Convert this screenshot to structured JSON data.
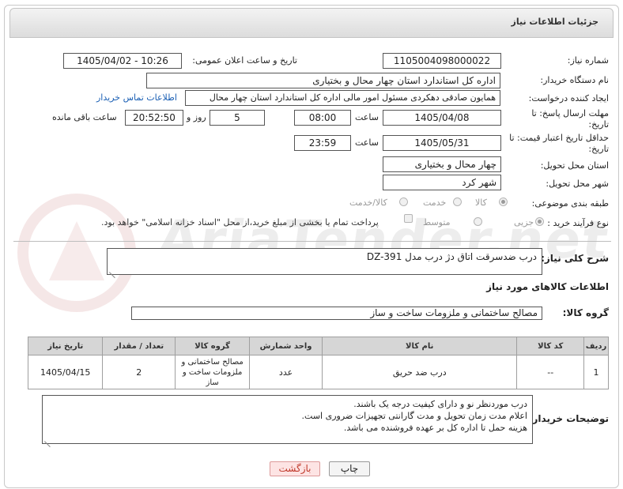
{
  "header": {
    "title": "جزئیات اطلاعات نیاز"
  },
  "form": {
    "need_number_label": "شماره نیاز:",
    "need_number": "1105004098000022",
    "announce_label": "تاریخ و ساعت اعلان عمومی:",
    "announce_value": "1405/04/02 - 10:26",
    "buyer_label": "نام دستگاه خریدار:",
    "buyer_value": "اداره کل استاندارد استان چهار محال و بختیاری",
    "creator_label": "ایجاد کننده درخواست:",
    "creator_value": "همایون صادقی دهکردی مسئول امور مالی اداره کل استاندارد استان چهار محال",
    "contact_link": "اطلاعات تماس خریدار",
    "reply_label": "مهلت ارسال پاسخ: تا تاریخ:",
    "reply_date": "1405/04/08",
    "time_word": "ساعت",
    "reply_time": "08:00",
    "days_value": "5",
    "days_word": "روز و",
    "remaining_value": "20:52:50",
    "remaining_word": "ساعت باقی مانده",
    "validity_label": "حداقل تاریخ اعتبار قیمت: تا تاریخ:",
    "validity_date": "1405/05/31",
    "validity_time": "23:59",
    "province_label": "استان محل تحویل:",
    "province_value": "چهار محال و بختیاری",
    "city_label": "شهر محل تحویل:",
    "city_value": "شهر کرد",
    "category_label": "طبقه بندی موضوعی:",
    "category_options": [
      "کالا",
      "خدمت",
      "کالا/خدمت"
    ],
    "category_selected": "کالا",
    "process_label": "نوع فرآیند خرید :",
    "process_options": [
      "جزیی",
      "متوسط"
    ],
    "process_selected": "جزیی",
    "payment_text": "پرداخت تمام یا بخشی از مبلغ خرید،از محل \"اسناد خزانه اسلامی\" خواهد بود."
  },
  "description": {
    "label": "شرح کلی نیاز:",
    "value": "درب ضدسرقت اتاق دژ درب مدل DZ-391"
  },
  "goods": {
    "section_title": "اطلاعات کالاهای مورد نیاز",
    "group_label": "گروه کالا:",
    "group_value": "مصالح ساختمانی و ملزومات ساخت و ساز",
    "columns": [
      "ردیف",
      "کد کالا",
      "نام کالا",
      "واحد شمارش",
      "گروه کالا",
      "تعداد / مقدار",
      "تاریخ نیاز"
    ],
    "rows": [
      [
        "1",
        "--",
        "درب ضد حریق",
        "عدد",
        "مصالح ساختمانی و ملزومات ساخت و ساز",
        "2",
        "1405/04/15"
      ]
    ]
  },
  "notes": {
    "label": "توضیحات خریدار:",
    "lines": [
      "درب موردنظر نو و دارای کیفیت درجه یک باشند.",
      "اعلام مدت زمان تحویل و مدت گارانتی تجهیزات ضروری است.",
      "هزینه حمل تا اداره کل بر عهده فروشنده می باشد."
    ]
  },
  "buttons": {
    "print": "چاپ",
    "back": "بازگشت"
  },
  "colors": {
    "link": "#1a5fb4",
    "back_button_bg": "#fde4e4",
    "back_button_text": "#c0392b"
  }
}
